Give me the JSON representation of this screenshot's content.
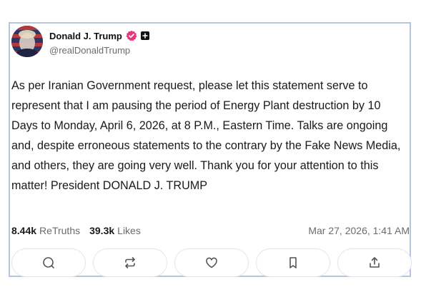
{
  "post": {
    "author_name": "Donald J. Trump",
    "author_handle": "@realDonaldTrump",
    "icons": {
      "verified": "verified-badge-icon",
      "plus": "plus-badge-icon"
    },
    "text": "As per Iranian Government request, please let this statement serve to represent that I am pausing the period of Energy Plant destruction by 10 Days to Monday, April 6, 2026, at 8 P.M., Eastern Time. Talks are ongoing and, despite erroneous statements to the contrary by the Fake News Media, and others, they are going very well. Thank you for your attention to this matter! President DONALD J. TRUMP",
    "retruths_count": "8.44k",
    "retruths_label": "ReTruths",
    "likes_count": "39.3k",
    "likes_label": "Likes",
    "timestamp": "Mar 27, 2026, 1:41 AM"
  },
  "actions": [
    {
      "icon": "reply-icon"
    },
    {
      "icon": "retruth-icon"
    },
    {
      "icon": "like-icon"
    },
    {
      "icon": "bookmark-icon"
    },
    {
      "icon": "share-icon"
    }
  ],
  "colors": {
    "card_border": "#b8c3de",
    "verified_badge": "#e2397a",
    "muted_text": "#6b6b6b"
  }
}
